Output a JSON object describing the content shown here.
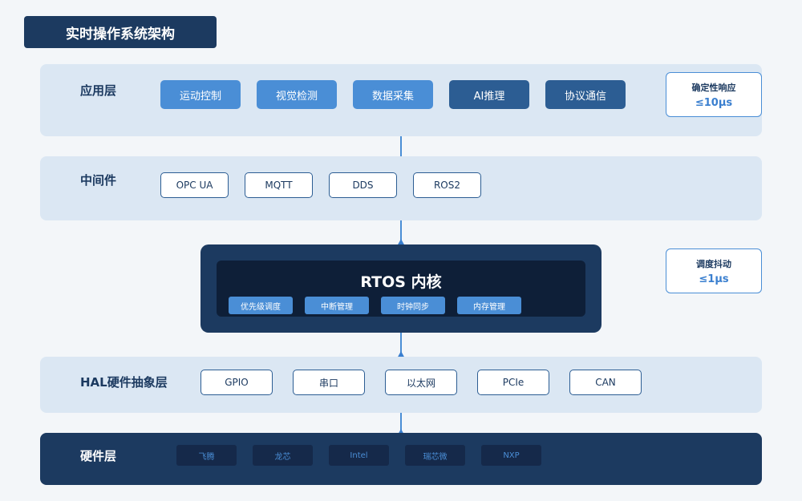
{
  "title": "实时操作系统架构",
  "layers": {
    "app": {
      "label": "应用层",
      "items": [
        "运动控制",
        "视觉检测",
        "数据采集",
        "AI推理",
        "协议通信"
      ]
    },
    "middleware": {
      "label": "中间件",
      "items": [
        "OPC UA",
        "MQTT",
        "DDS",
        "ROS2"
      ]
    },
    "kernel": {
      "label": "RTOS 内核",
      "items": [
        "优先级调度",
        "中断管理",
        "时钟同步",
        "内存管理"
      ]
    },
    "hal": {
      "label": "HAL硬件抽象层",
      "items": [
        "GPIO",
        "串口",
        "以太网",
        "PCIe",
        "CAN"
      ]
    },
    "hardware": {
      "label": "硬件层",
      "items": [
        "飞腾",
        "龙芯",
        "Intel",
        "瑞芯微",
        "NXP"
      ]
    }
  },
  "metrics": [
    {
      "label": "确定性响应",
      "value": "≤10μs"
    },
    {
      "label": "调度抖动",
      "value": "≤1μs"
    }
  ],
  "colors": {
    "navy": "#1c3a60",
    "deep_navy": "#0e1f38",
    "accent_blue": "#4a8ed6",
    "mid_blue": "#2c5d93",
    "layer_bg": "#dbe7f3",
    "page_bg": "#f3f6f9"
  }
}
